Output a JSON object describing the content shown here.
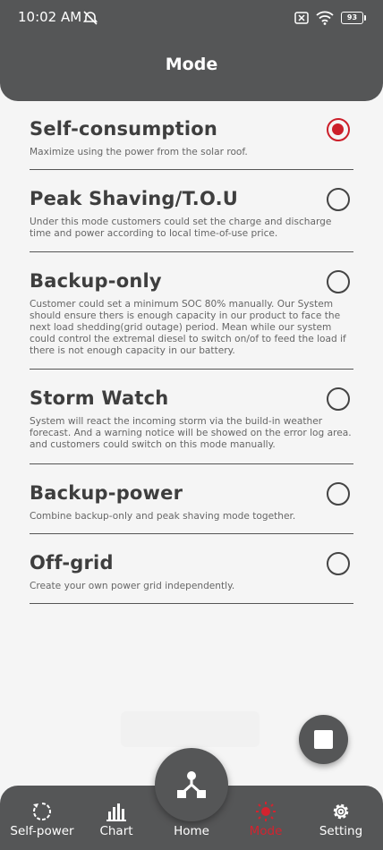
{
  "status_bar": {
    "time": "10:02 AM",
    "battery": "93"
  },
  "header": {
    "title": "Mode"
  },
  "modes": [
    {
      "title": "Self-consumption",
      "description": "Maximize using the power from the solar roof.",
      "selected": true
    },
    {
      "title": "Peak Shaving/T.O.U",
      "description": "Under this mode customers could set the charge and discharge time and power according to local time-of-use price.",
      "selected": false
    },
    {
      "title": "Backup-only",
      "description": "Customer could set a minimum SOC 80% manually. Our System should ensure thers is enough capacity in our product to face the next load shedding(grid outage) period. Mean while our system could control the extremal diesel to switch on/of to feed the load if there is not enough capacity in our battery.",
      "selected": false
    },
    {
      "title": "Storm Watch",
      "description": "System will react the incoming storm via the build-in weather forecast. And a warning notice will be showed on the error log area. and customers could switch on this mode manually.",
      "selected": false
    },
    {
      "title": "Backup-power",
      "description": "Combine backup-only and peak shaving mode together.",
      "selected": false
    },
    {
      "title": "Off-grid",
      "description": "Create your own power grid independently.",
      "selected": false
    }
  ],
  "bottom_nav": {
    "items": [
      {
        "label": "Self-power",
        "icon": "circle-arrow-icon"
      },
      {
        "label": "Chart",
        "icon": "bar-chart-icon"
      },
      {
        "label": "Home",
        "icon": "network-icon"
      },
      {
        "label": "Mode",
        "icon": "sun-icon",
        "active": true
      },
      {
        "label": "Setting",
        "icon": "gear-icon"
      }
    ]
  },
  "colors": {
    "accent": "#d3232f",
    "header_bg": "#555657",
    "background": "#f5f5f5"
  }
}
